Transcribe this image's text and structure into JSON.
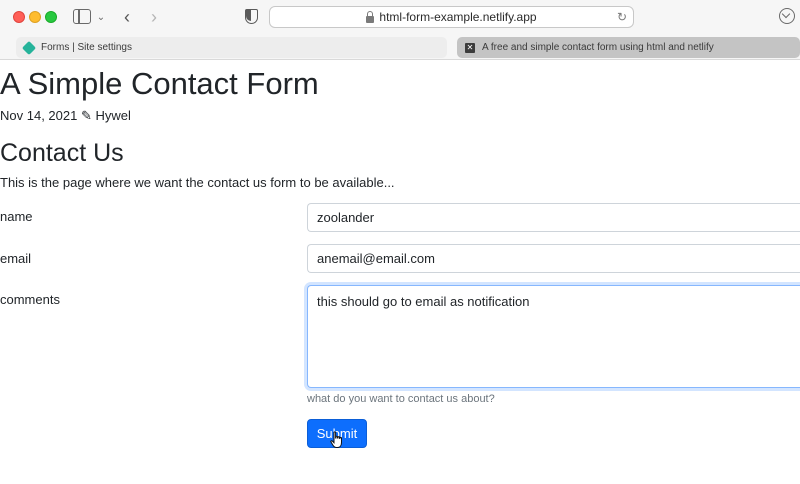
{
  "browser": {
    "url": "html-form-example.netlify.app",
    "tabs": [
      {
        "label": "Forms | Site settings",
        "icon": "netlify-diamond-icon",
        "active": false
      },
      {
        "label": "A free and simple contact form using html and netlify",
        "icon": "close-icon",
        "active": true
      }
    ]
  },
  "page": {
    "title": "A Simple Contact Form",
    "date": "Nov 14, 2021",
    "author_icon": "✎",
    "author": "Hywel",
    "section_title": "Contact Us",
    "intro": "This is the page where we want the contact us form to be available..."
  },
  "form": {
    "name_label": "name",
    "name_value": "zoolander",
    "email_label": "email",
    "email_value": "anemail@email.com",
    "comments_label": "comments",
    "comments_value": "this should go to email as notification",
    "comments_help": "what do you want to contact us about?",
    "submit_label": "Submit"
  },
  "colors": {
    "primary": "#0d6efd",
    "focus_border": "#86b7fe",
    "muted": "#6c757d"
  }
}
